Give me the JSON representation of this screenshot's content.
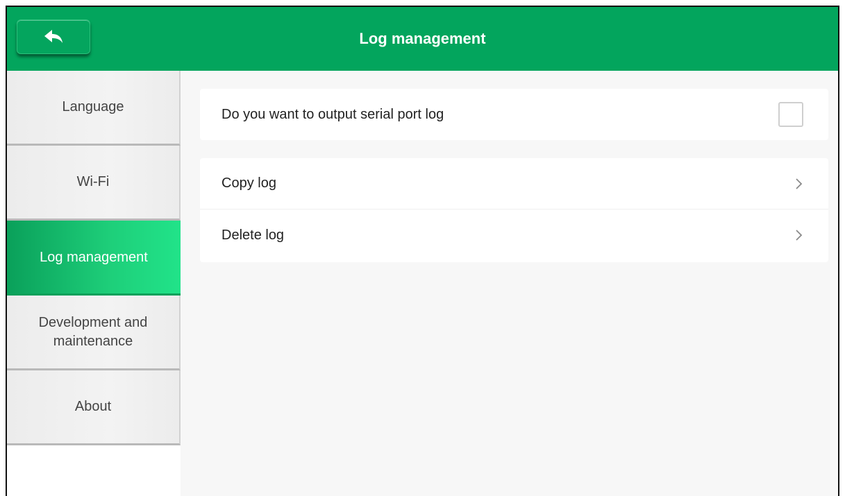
{
  "header": {
    "title": "Log management",
    "back_icon": "back-arrow-icon"
  },
  "sidebar": {
    "items": [
      {
        "label": "Language",
        "active": false
      },
      {
        "label": "Wi-Fi",
        "active": false
      },
      {
        "label": "Log management",
        "active": true
      },
      {
        "label": "Development and maintenance",
        "active": false
      },
      {
        "label": "About",
        "active": false
      }
    ]
  },
  "main": {
    "serial_log": {
      "label": "Do you want to output serial port log",
      "checked": false
    },
    "actions": [
      {
        "label": "Copy log",
        "icon": "chevron-right-icon"
      },
      {
        "label": "Delete log",
        "icon": "chevron-right-icon"
      }
    ]
  },
  "colors": {
    "brand": "#03a55d",
    "active_gradient_end": "#21e389"
  }
}
